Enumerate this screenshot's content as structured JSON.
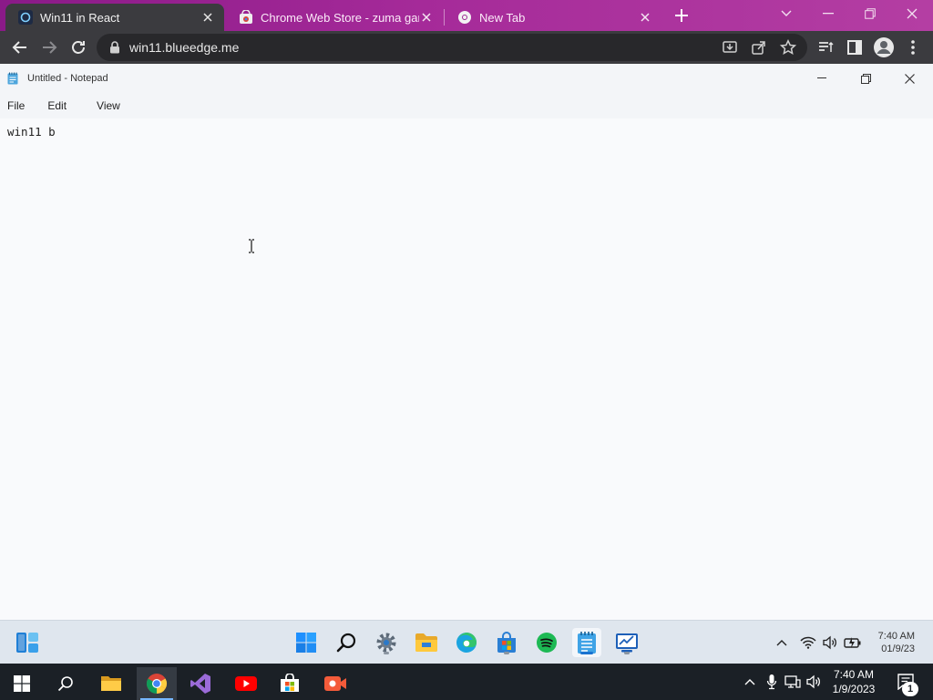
{
  "browser": {
    "tabs": [
      {
        "title": "Win11 in React",
        "icon": "win11-favicon",
        "active": true
      },
      {
        "title": "Chrome Web Store - zuma game",
        "icon": "chrome-web-store-icon",
        "active": false
      },
      {
        "title": "New Tab",
        "icon": "chrome-icon",
        "active": false
      }
    ],
    "url": "win11.blueedge.me"
  },
  "notepad": {
    "title": "Untitled - Notepad",
    "menu": [
      "File",
      "Edit",
      "View"
    ],
    "content": "win11 b"
  },
  "win11_taskbar": {
    "apps": [
      "widgets-icon",
      "start-icon",
      "search-icon",
      "settings-icon",
      "file-explorer-icon",
      "edge-icon",
      "store-icon",
      "spotify-icon",
      "notepad-icon",
      "whiteboard-icon"
    ],
    "time": "7:40 AM",
    "date": "01/9/23"
  },
  "host_taskbar": {
    "apps": [
      "windows-start-icon",
      "search-icon",
      "file-explorer-icon",
      "chrome-icon",
      "visual-studio-icon",
      "youtube-icon",
      "store-icon",
      "screen-recorder-icon"
    ],
    "time": "7:40 AM",
    "date": "1/9/2023",
    "notification_count": "1"
  },
  "colors": {
    "tab_strip": "#a52a99",
    "toolbar": "#3b3b3f",
    "accent": "#1a73d0"
  }
}
